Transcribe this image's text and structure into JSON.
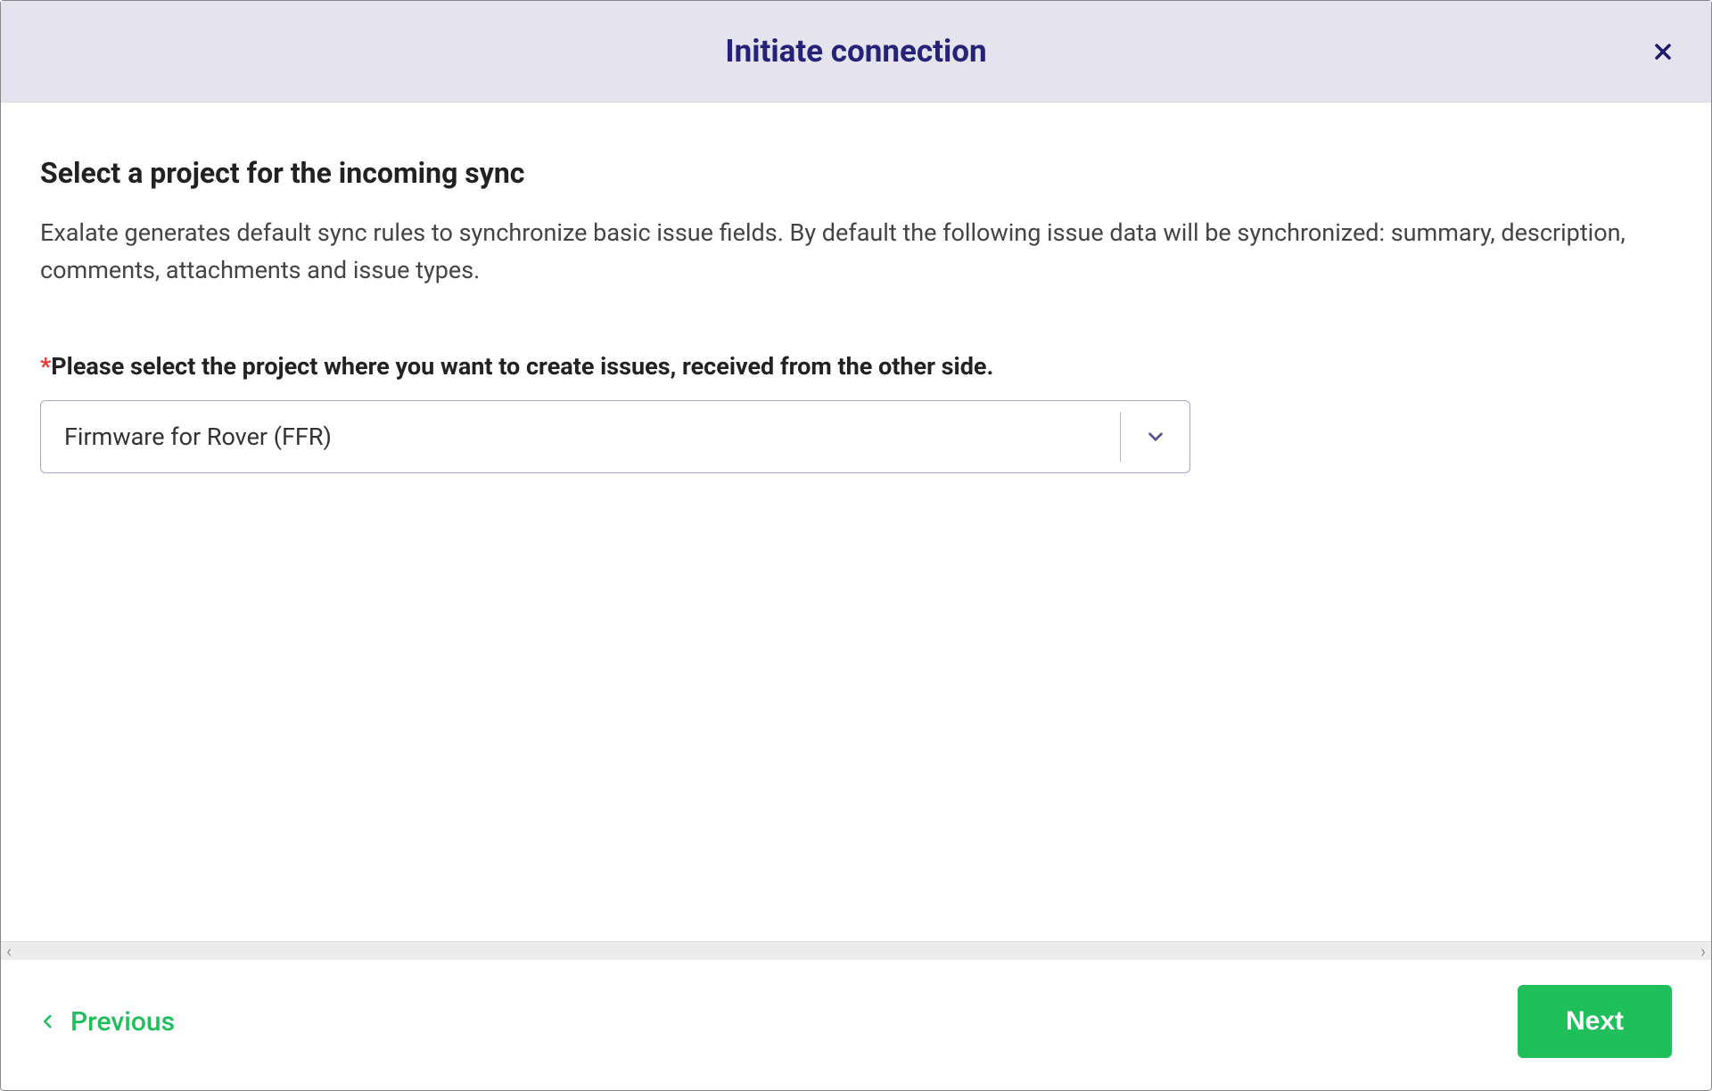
{
  "header": {
    "title": "Initiate connection"
  },
  "body": {
    "heading": "Select a project for the incoming sync",
    "description": "Exalate generates default sync rules to synchronize basic issue fields. By default the following issue data will be synchronized: summary, description, comments, attachments and issue types.",
    "field_label": "Please select the project where you want to create issues, received from the other side.",
    "select_value": "Firmware for Rover (FFR)"
  },
  "footer": {
    "previous_label": "Previous",
    "next_label": "Next"
  }
}
